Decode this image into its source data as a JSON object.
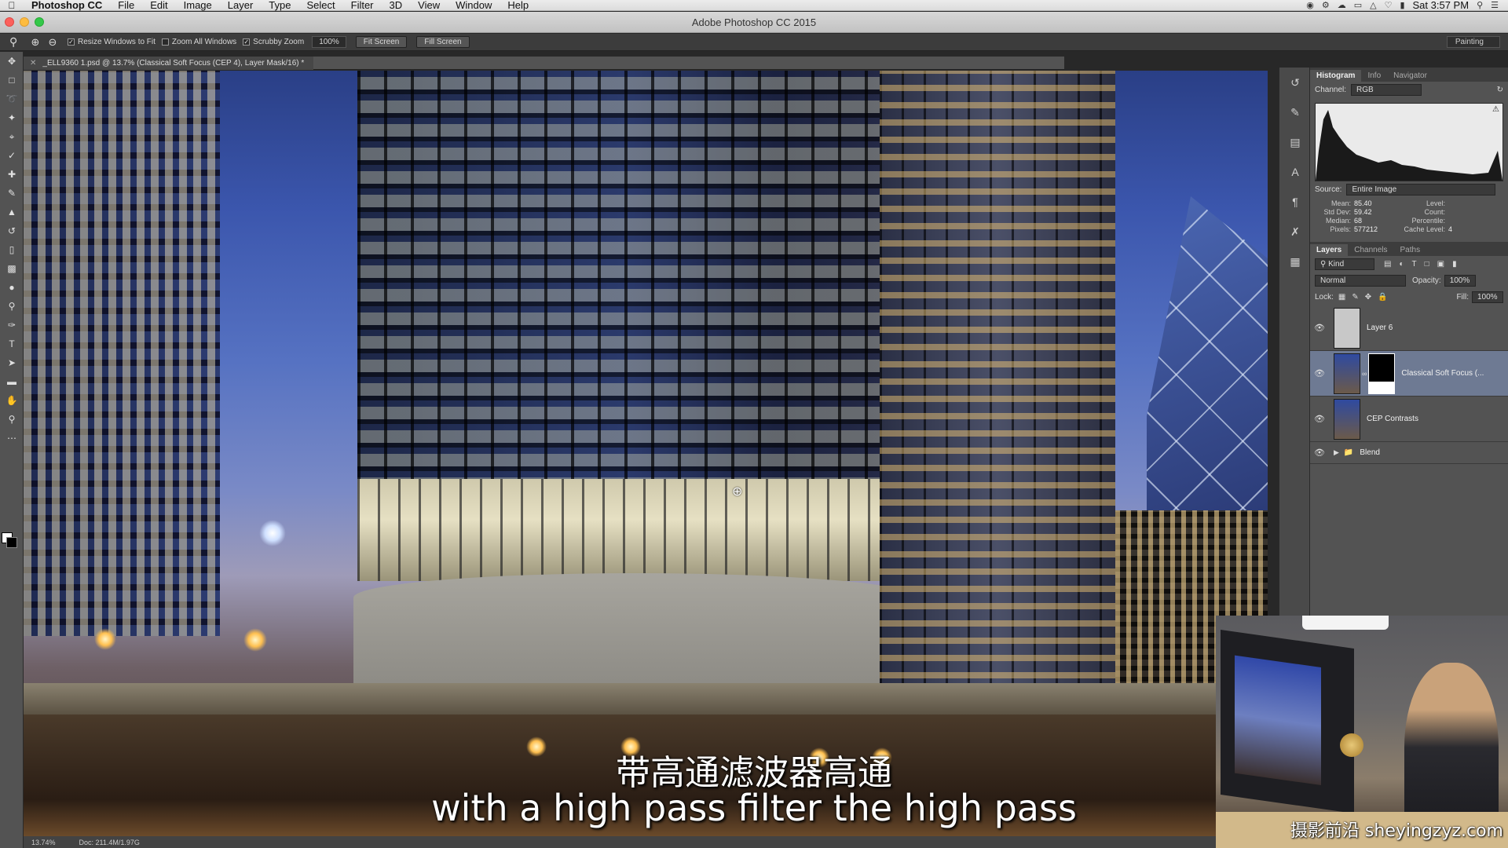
{
  "menubar": {
    "app_name": "Photoshop CC",
    "items": [
      "File",
      "Edit",
      "Image",
      "Layer",
      "Type",
      "Select",
      "Filter",
      "3D",
      "View",
      "Window",
      "Help"
    ],
    "clock": "Sat 3:57 PM"
  },
  "titlebar": {
    "title": "Adobe Photoshop CC 2015"
  },
  "options": {
    "resize_windows": "Resize Windows to Fit",
    "zoom_all": "Zoom All Windows",
    "scrubby_zoom": "Scrubby Zoom",
    "zoom_pct": "100%",
    "fit_screen": "Fit Screen",
    "fill_screen": "Fill Screen",
    "workspace": "Painting"
  },
  "document": {
    "tab_title": "_ELL9360 1.psd @ 13.7% (Classical Soft Focus (CEP 4), Layer Mask/16) *"
  },
  "status": {
    "zoom": "13.74%",
    "doc_size": "Doc: 211.4M/1.97G"
  },
  "histogram_panel": {
    "tabs": [
      "Histogram",
      "Info",
      "Navigator"
    ],
    "channel_label": "Channel:",
    "channel_value": "RGB",
    "source_label": "Source:",
    "source_value": "Entire Image",
    "stats": {
      "mean_label": "Mean:",
      "mean": "85.40",
      "std_label": "Std Dev:",
      "std": "59.42",
      "median_label": "Median:",
      "median": "68",
      "pixels_label": "Pixels:",
      "pixels": "577212",
      "level_label": "Level:",
      "count_label": "Count:",
      "percentile_label": "Percentile:",
      "cache_label": "Cache Level:",
      "cache": "4"
    }
  },
  "layers_panel": {
    "tabs": [
      "Layers",
      "Channels",
      "Paths"
    ],
    "kind_label": "Kind",
    "blend_mode": "Normal",
    "opacity_label": "Opacity:",
    "opacity": "100%",
    "lock_label": "Lock:",
    "fill_label": "Fill:",
    "fill": "100%",
    "layers": [
      {
        "name": "Layer 6"
      },
      {
        "name": "Classical Soft Focus (..."
      },
      {
        "name": "CEP Contrasts"
      },
      {
        "name": "Blend"
      }
    ]
  },
  "subtitles": {
    "chinese": "带高通滤波器高通",
    "english": "with a high pass filter the high pass"
  },
  "watermark": "摄影前沿 sheyingzyz.com"
}
